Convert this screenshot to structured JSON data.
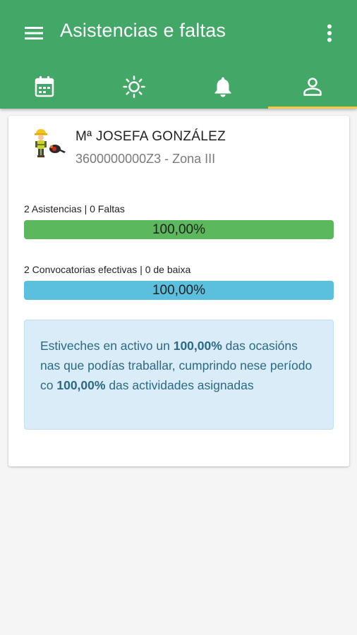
{
  "app": {
    "title": "Asistencias e faltas"
  },
  "icons": {
    "menu": "menu-icon",
    "overflow": "more-vert-icon",
    "tabs": [
      "calendar-icon",
      "sun-icon",
      "bell-icon",
      "person-icon"
    ]
  },
  "tabs": {
    "active_index": 3
  },
  "profile": {
    "name": "Mª JOSEFA GONZÁLEZ",
    "id_zone": "3600000000Z3 - Zona III"
  },
  "stats": {
    "attendance": {
      "label": "2 Asistencias | 0 Faltas",
      "percent_text": "100,00%",
      "fraction": 1.0,
      "color": "#5cb85c"
    },
    "convocations": {
      "label": "2 Convocatorias efectivas | 0 de baixa",
      "percent_text": "100,00%",
      "fraction": 1.0,
      "color": "#5bc0de"
    }
  },
  "summary": {
    "part1": "Estiveches en activo un ",
    "value1": "100,00%",
    "part2": " das ocasións nas que podías traballar, cumprindo nese período co ",
    "value2": "100,00%",
    "part3": " das actividades asignadas"
  },
  "colors": {
    "primary": "#43a867",
    "tab_indicator": "#f6c94a"
  }
}
